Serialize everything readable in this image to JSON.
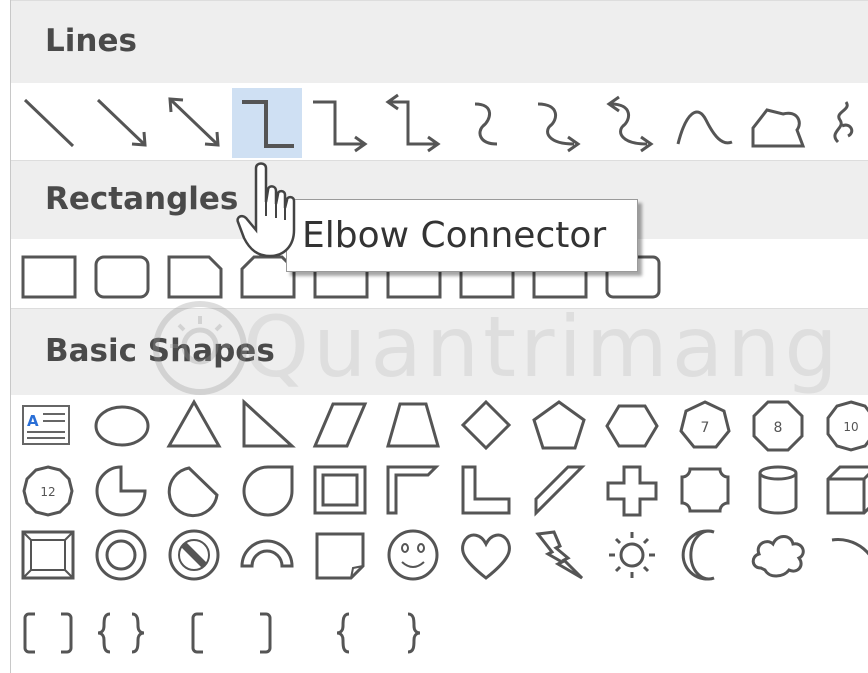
{
  "gallery": {
    "sections": {
      "lines": {
        "label": "Lines"
      },
      "rectangles": {
        "label": "Rectangles"
      },
      "basic_shapes": {
        "label": "Basic Shapes"
      }
    },
    "tooltip": {
      "text": "Elbow Connector"
    },
    "selected_item": "elbow-connector"
  },
  "watermark": {
    "text": "Quantrimang"
  },
  "colors": {
    "selection": "#cfe0f3",
    "header_bg": "#eeeeee",
    "shape_stroke": "#555555"
  }
}
